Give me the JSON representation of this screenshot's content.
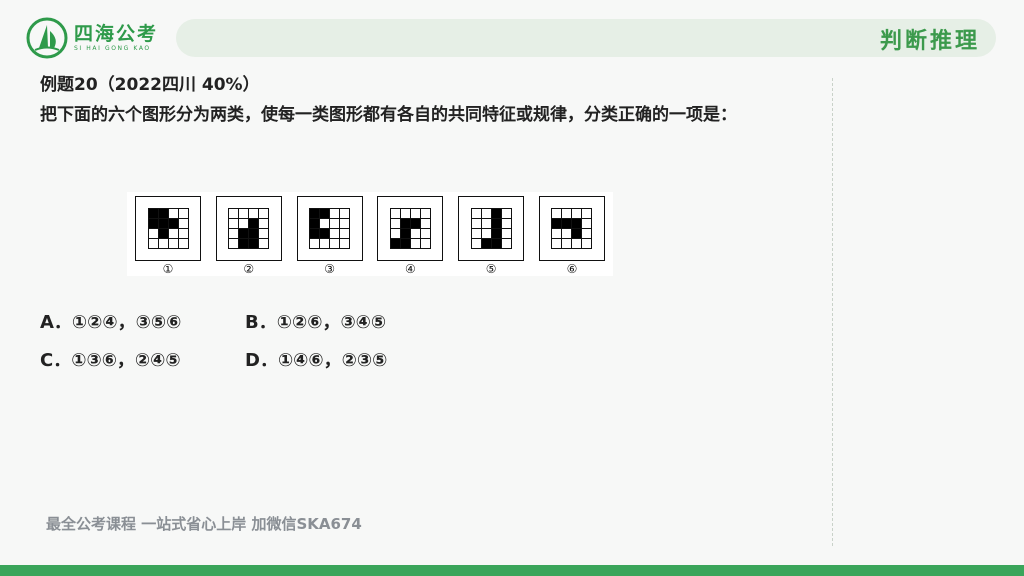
{
  "logo": {
    "title": "四海公考",
    "subtitle": "SI HAI GONG KAO",
    "icon": "sail-logo-icon"
  },
  "header": {
    "section_title": "判断推理"
  },
  "question": {
    "heading": "例题20（2022四川 40%）",
    "body": "把下面的六个图形分为两类，使每一类图形都有各自的共同特征或规律，分类正确的一项是："
  },
  "figures": [
    {
      "label": "①",
      "cells": [
        1,
        1,
        0,
        0,
        1,
        1,
        1,
        0,
        0,
        1,
        0,
        0,
        0,
        0,
        0,
        0
      ]
    },
    {
      "label": "②",
      "cells": [
        0,
        0,
        0,
        0,
        0,
        0,
        1,
        0,
        0,
        1,
        1,
        0,
        0,
        1,
        1,
        0
      ]
    },
    {
      "label": "③",
      "cells": [
        1,
        1,
        0,
        0,
        1,
        0,
        0,
        0,
        1,
        1,
        0,
        0,
        0,
        0,
        0,
        0
      ]
    },
    {
      "label": "④",
      "cells": [
        0,
        0,
        0,
        0,
        0,
        1,
        1,
        0,
        0,
        1,
        0,
        0,
        1,
        1,
        0,
        0
      ]
    },
    {
      "label": "⑤",
      "cells": [
        0,
        0,
        1,
        0,
        0,
        0,
        1,
        0,
        0,
        0,
        1,
        0,
        0,
        1,
        1,
        0
      ]
    },
    {
      "label": "⑥",
      "cells": [
        0,
        0,
        0,
        0,
        1,
        1,
        1,
        0,
        0,
        0,
        1,
        0,
        0,
        0,
        0,
        0
      ]
    }
  ],
  "options": {
    "A": "A．①②④，③⑤⑥",
    "B": "B．①②⑥，③④⑤",
    "C": "C．①③⑥，②④⑤",
    "D": "D．①④⑥，②③⑤"
  },
  "footer": {
    "note": "最全公考课程 一站式省心上岸 加微信SKA674"
  },
  "colors": {
    "brand_green": "#3aa55a",
    "header_bar": "#e6efe6",
    "footer_text": "#8a8f95"
  }
}
